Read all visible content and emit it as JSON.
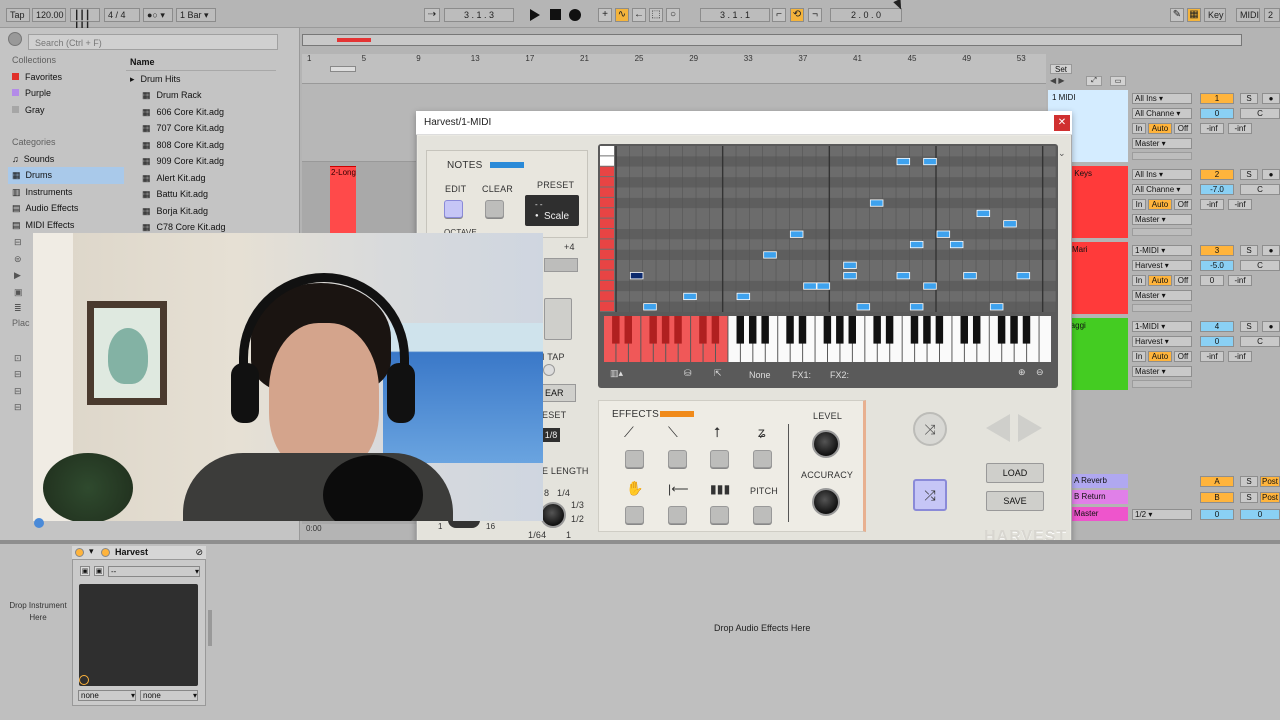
{
  "toolbar": {
    "tap": "Tap",
    "tempo": "120.00",
    "signature": "4 / 4",
    "quantize": "1 Bar",
    "position": "3 .  1 .  3",
    "loop_start": "3 .  1 .  1",
    "loop_length": "2 .  0 .  0",
    "key": "Key",
    "midi": "MIDI",
    "cpu": "2 %"
  },
  "browser": {
    "search_placeholder": "Search (Ctrl + F)",
    "collections_title": "Collections",
    "collections": [
      {
        "label": "Favorites",
        "color": "#e0302a"
      },
      {
        "label": "Purple",
        "color": "#b38be8"
      },
      {
        "label": "Gray",
        "color": "#a6a6a6"
      }
    ],
    "categories_title": "Categories",
    "categories": [
      "Sounds",
      "Drums",
      "Instruments",
      "Audio Effects",
      "MIDI Effects"
    ],
    "places_title": "Plac",
    "name_header": "Name",
    "files": [
      "Drum Hits",
      "Drum Rack",
      "606 Core Kit.adg",
      "707 Core Kit.adg",
      "808 Core Kit.adg",
      "909 Core Kit.adg",
      "Alert Kit.adg",
      "Battu Kit.adg",
      "Borja Kit.adg",
      "C78 Core Kit.adg"
    ]
  },
  "arrangement": {
    "ruler": [
      "1",
      "5",
      "9",
      "13",
      "17",
      "21",
      "25",
      "29",
      "33",
      "37",
      "41",
      "45",
      "49",
      "53"
    ],
    "clip_label": "2-Long",
    "time_marker": "0:00"
  },
  "mixer": {
    "set_label": "Set",
    "tracks": [
      {
        "name": "1 MIDI",
        "color": "#d4ecff",
        "input": "All Ins",
        "channel": "All Channe",
        "in": "In",
        "auto": "Auto",
        "off": "Off",
        "vol": "-inf",
        "pan": "-inf",
        "out": "Master",
        "number": "1",
        "send": "0",
        "c": "C",
        "s": "S"
      },
      {
        "name": "Silver Keys",
        "color": "#ff3a3a",
        "input": "All Ins",
        "channel": "All Channe",
        "in": "In",
        "auto": "Auto",
        "off": "Off",
        "vol": "-inf",
        "pan": "-inf",
        "out": "Master",
        "number": "2",
        "send": "-7.0",
        "c": "C",
        "s": "S"
      },
      {
        "name": "Long Mari",
        "color": "#ff3a3a",
        "input": "1-MIDI",
        "channel": "Harvest",
        "in": "In",
        "auto": "Auto",
        "off": "Off",
        "vol": "0",
        "pan": "-inf",
        "out": "Master",
        "number": "3",
        "send": "-5.0",
        "c": "C",
        "s": "S"
      },
      {
        "name": "Formaggi",
        "color": "#44cc22",
        "input": "1-MIDI",
        "channel": "Harvest",
        "in": "In",
        "auto": "Auto",
        "off": "Off",
        "vol": "-inf",
        "pan": "-inf",
        "out": "Master",
        "number": "4",
        "send": "0",
        "c": "C",
        "s": "S"
      }
    ],
    "returns": [
      {
        "name": "A Reverb",
        "color": "#b0a8f0",
        "letter": "A",
        "s": "S",
        "post": "Post"
      },
      {
        "name": "B Return",
        "color": "#e080e8",
        "letter": "B",
        "s": "S",
        "post": "Post"
      }
    ],
    "master": {
      "name": "Master",
      "color": "#ee55cc",
      "cue": "1/2",
      "vol": "0",
      "pan": "0"
    }
  },
  "plugin": {
    "title": "Harvest/1-MIDI",
    "notes_label": "NOTES",
    "edit_label": "EDIT",
    "clear_label": "CLEAR",
    "preset_label": "PRESET",
    "scale_label": "Scale",
    "preset_dash": "-   -",
    "octave_label": "OCTAVE",
    "plus4": "+4",
    "tap_label": "I TAP",
    "ear_label": "EAR",
    "reset_label": "ESET",
    "div_label": "1/8",
    "length_label": "E LENGTH",
    "len_vals": [
      "8",
      "1/4",
      "1/3",
      "1/2",
      "1/64",
      "1"
    ],
    "len_nums": [
      "1",
      "16"
    ],
    "roll_footer": {
      "none": "None",
      "fx1": "FX1:",
      "fx2": "FX2:"
    },
    "effects_label": "EFFECTS",
    "pitch_label": "PITCH",
    "level_label": "LEVEL",
    "accuracy_label": "ACCURACY",
    "load_label": "LOAD",
    "save_label": "SAVE",
    "brand": "HARVEST",
    "notes": [
      [
        0,
        12,
        1
      ],
      [
        9,
        15,
        2
      ],
      [
        10,
        14,
        5
      ],
      [
        11,
        14,
        9
      ],
      [
        12,
        10,
        11
      ],
      [
        13,
        8,
        13
      ],
      [
        14,
        13,
        14
      ],
      [
        15,
        13,
        15
      ],
      [
        16,
        12,
        17
      ],
      [
        17,
        11,
        17
      ],
      [
        18,
        15,
        18
      ],
      [
        19,
        5,
        19
      ],
      [
        20,
        1,
        21
      ],
      [
        21,
        12,
        21
      ],
      [
        22,
        15,
        22
      ],
      [
        23,
        9,
        22
      ],
      [
        24,
        13,
        23
      ],
      [
        25,
        1,
        23
      ],
      [
        26,
        8,
        24
      ],
      [
        27,
        9,
        25
      ],
      [
        28,
        12,
        26
      ],
      [
        29,
        6,
        27
      ],
      [
        30,
        15,
        28
      ],
      [
        31,
        7,
        29
      ],
      [
        32,
        12,
        30
      ]
    ]
  },
  "device": {
    "name": "Harvest",
    "preset": "--",
    "drop_instrument": "Drop Instrument Here",
    "drop_effects": "Drop Audio Effects Here",
    "sel1": "none",
    "sel2": "none"
  }
}
